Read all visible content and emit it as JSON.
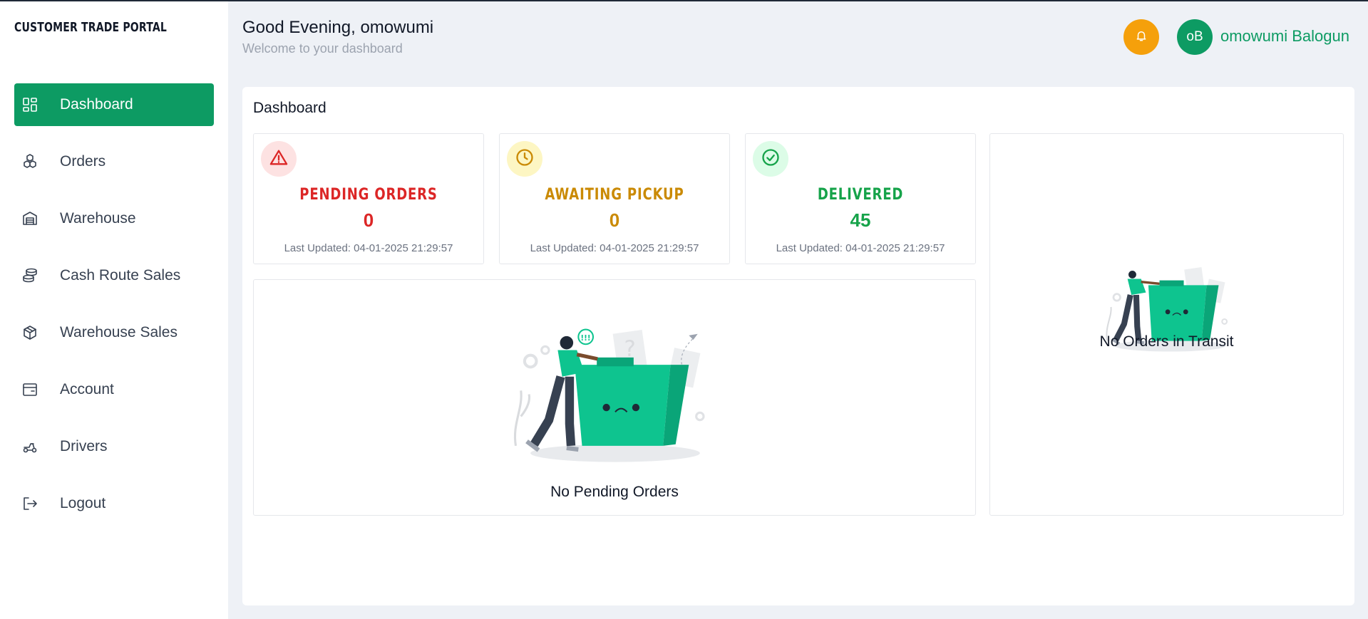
{
  "app": {
    "title": "CUSTOMER TRADE PORTAL"
  },
  "sidebar": {
    "items": [
      {
        "label": "Dashboard",
        "icon": "dashboard-icon",
        "active": true
      },
      {
        "label": "Orders",
        "icon": "orders-icon"
      },
      {
        "label": "Warehouse",
        "icon": "warehouse-icon"
      },
      {
        "label": "Cash Route Sales",
        "icon": "cash-stack-icon"
      },
      {
        "label": "Warehouse Sales",
        "icon": "package-icon"
      },
      {
        "label": "Account",
        "icon": "account-card-icon"
      },
      {
        "label": "Drivers",
        "icon": "scooter-icon"
      },
      {
        "label": "Logout",
        "icon": "logout-icon"
      }
    ]
  },
  "header": {
    "greeting": "Good Evening, omowumi",
    "subtitle": "Welcome to your dashboard",
    "notification_icon": "bell-icon",
    "user": {
      "initials": "oB",
      "name": "omowumi Balogun"
    }
  },
  "dashboard": {
    "title": "Dashboard",
    "stats": [
      {
        "label": "PENDING ORDERS",
        "value": "0",
        "updated": "Last Updated: 04-01-2025 21:29:57",
        "icon": "warning-triangle-icon",
        "color": "#dc2626",
        "bg": "#fde2e2"
      },
      {
        "label": "AWAITING PICKUP",
        "value": "0",
        "updated": "Last Updated: 04-01-2025 21:29:57",
        "icon": "clock-icon",
        "color": "#ca8a04",
        "bg": "#fdf6c3"
      },
      {
        "label": "DELIVERED",
        "value": "45",
        "updated": "Last Updated: 04-01-2025 21:29:57",
        "icon": "check-circle-icon",
        "color": "#16a34a",
        "bg": "#dcfce7"
      }
    ],
    "pending_empty": "No Pending Orders",
    "transit_empty": "No Orders in Transit"
  },
  "colors": {
    "accent": "#0d9b63",
    "bell": "#f5a00b",
    "illustration": "#0ec48f"
  }
}
